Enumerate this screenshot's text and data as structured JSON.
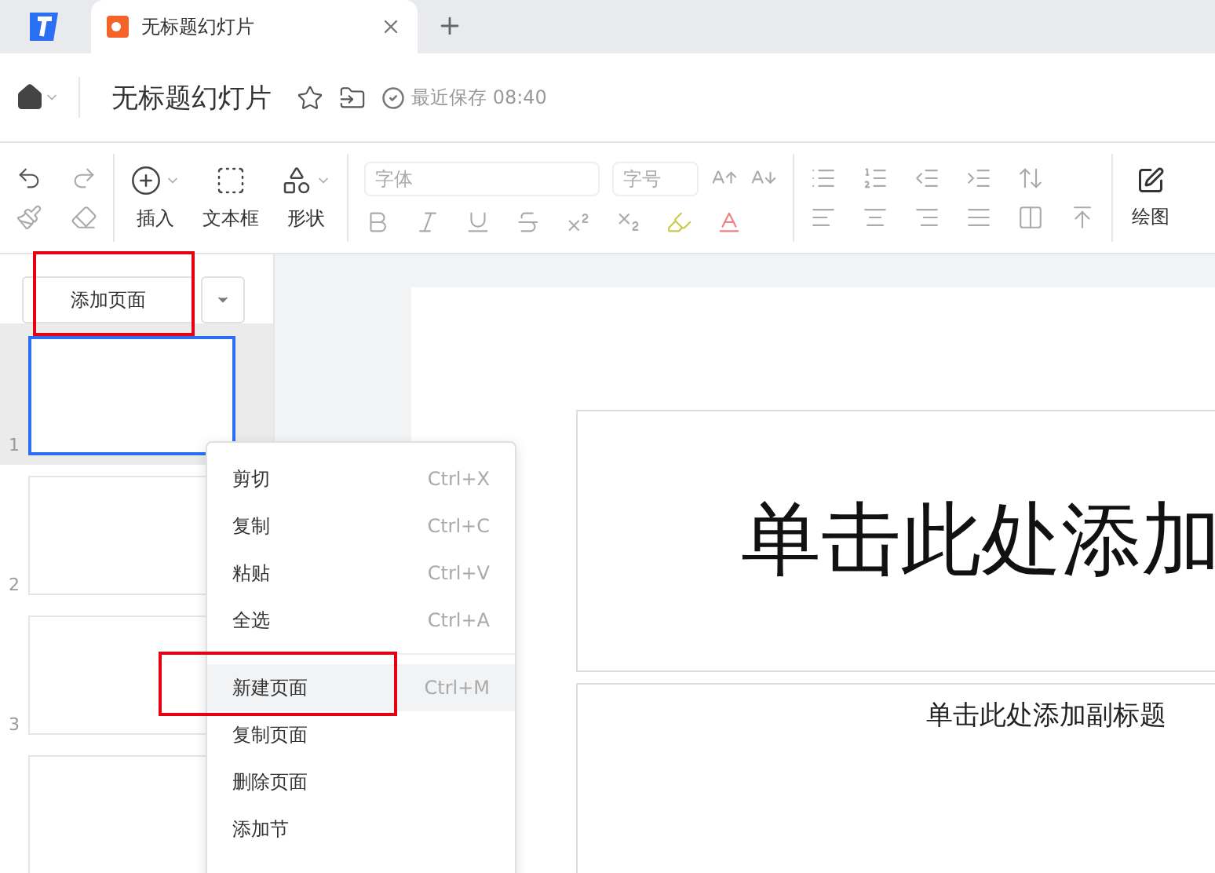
{
  "tabs": [
    {
      "title": "无标题幻灯片",
      "selected": true
    }
  ],
  "document": {
    "title": "无标题幻灯片",
    "save_status": "最近保存 08:40"
  },
  "toolbar": {
    "insert_buttons": [
      {
        "kind": "insert",
        "label": "插入"
      },
      {
        "kind": "textbox",
        "label": "文本框"
      },
      {
        "kind": "shape",
        "label": "形状"
      }
    ],
    "font": {
      "placeholder": "字体"
    },
    "size": {
      "placeholder": "字号"
    },
    "draw_button": {
      "label": "绘图"
    }
  },
  "add_page": {
    "label": "添加页面",
    "highlighted": true
  },
  "slides": [
    {
      "number": "1",
      "selected": true
    },
    {
      "number": "2",
      "selected": false
    },
    {
      "number": "3",
      "selected": false
    },
    {
      "selected": false
    }
  ],
  "context_menu": {
    "groups": [
      [
        {
          "label": "剪切",
          "shortcut": "Ctrl+X",
          "selected": false,
          "highlighted": false
        },
        {
          "label": "复制",
          "shortcut": "Ctrl+C",
          "selected": false,
          "highlighted": false
        },
        {
          "label": "粘贴",
          "shortcut": "Ctrl+V",
          "selected": false,
          "highlighted": false
        },
        {
          "label": "全选",
          "shortcut": "Ctrl+A",
          "selected": false,
          "highlighted": false
        }
      ],
      [
        {
          "label": "新建页面",
          "shortcut": "Ctrl+M",
          "selected": true,
          "highlighted": true
        },
        {
          "label": "复制页面",
          "selected": false,
          "highlighted": false
        },
        {
          "label": "删除页面",
          "selected": false,
          "highlighted": false
        },
        {
          "label": "添加节",
          "selected": false,
          "highlighted": false
        }
      ]
    ]
  },
  "slide": {
    "title_placeholder": "单击此处添加",
    "subtitle_placeholder": "单击此处添加副标题"
  }
}
